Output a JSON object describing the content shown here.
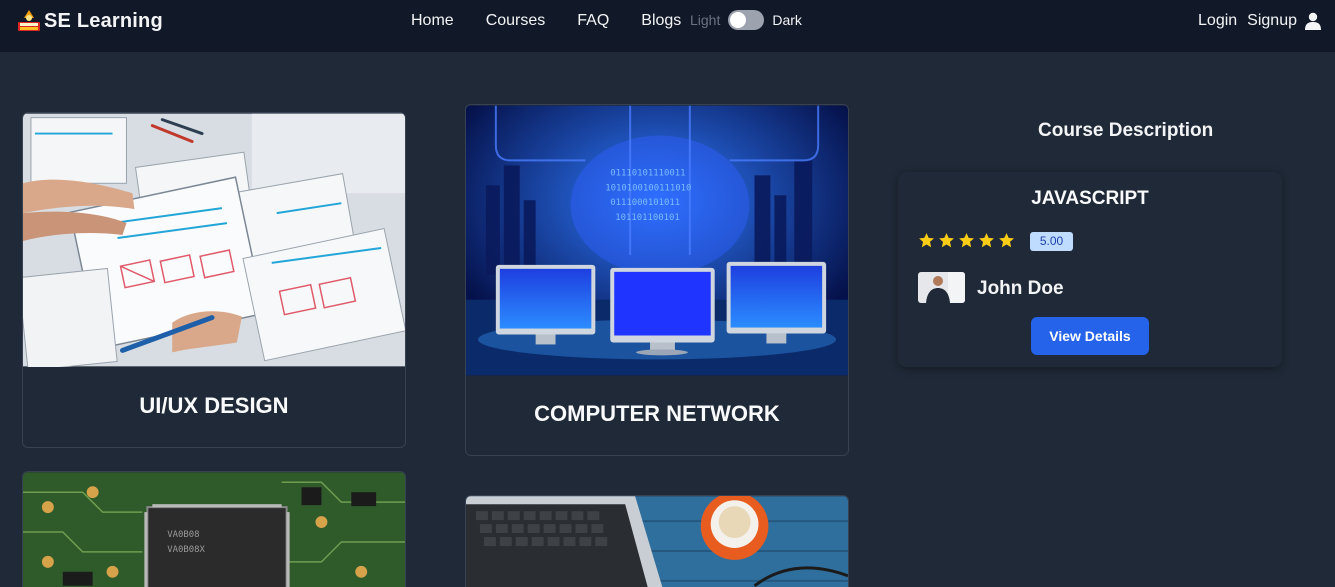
{
  "brand": {
    "name": "SE Learning"
  },
  "nav": {
    "links": [
      "Home",
      "Courses",
      "FAQ",
      "Blogs"
    ]
  },
  "theme": {
    "light_label": "Light",
    "dark_label": "Dark"
  },
  "auth": {
    "login": "Login",
    "signup": "Signup"
  },
  "courses": [
    {
      "title": "UI/UX DESIGN"
    },
    {
      "title": "COMPUTER NETWORK"
    },
    {
      "title": ""
    },
    {
      "title": ""
    }
  ],
  "sidebar": {
    "heading": "Course Description",
    "course_name": "JAVASCRIPT",
    "rating": "5.00",
    "stars": 5,
    "instructor": "John Doe",
    "button": "View Details"
  },
  "colors": {
    "navbar": "#111827",
    "background": "#1f2937",
    "accent": "#2563eb",
    "star": "#facc15",
    "badge": "#bfdbfe"
  }
}
